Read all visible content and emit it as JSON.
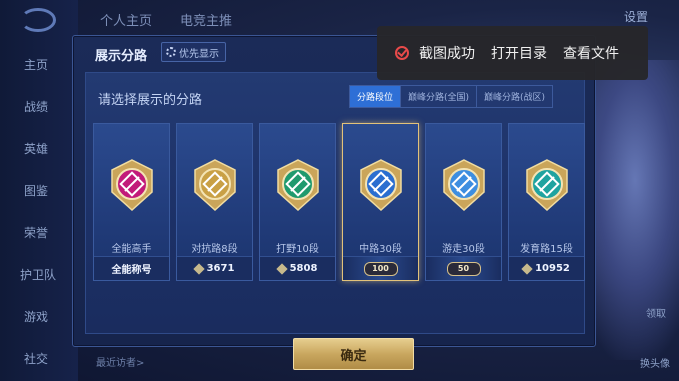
{
  "background": {
    "tabs": [
      "个人主页",
      "电竞主推"
    ],
    "settings_label": "设置",
    "nav": [
      "主页",
      "战绩",
      "英雄",
      "图鉴",
      "荣誉",
      "护卫队",
      "游戏",
      "社交"
    ],
    "bottom_text": "最近访者>",
    "side_labels": [
      "领取",
      "换头像"
    ]
  },
  "dialog": {
    "title": "展示分路",
    "pref_button": "优先显示",
    "prompt": "请选择展示的分路",
    "tabs": [
      "分路段位",
      "巅峰分路(全国)",
      "巅峰分路(战区)"
    ],
    "active_tab": 0,
    "cards": [
      {
        "name": "全能高手",
        "foot": "全能称号",
        "foot_type": "text",
        "emblem_color": "#c21a7a",
        "selected": false
      },
      {
        "name": "对抗路8段",
        "foot": "3671",
        "foot_type": "diamond",
        "emblem_color": "#c9a045",
        "selected": false
      },
      {
        "name": "打野10段",
        "foot": "5808",
        "foot_type": "diamond",
        "emblem_color": "#1f9a6e",
        "selected": false
      },
      {
        "name": "中路30段",
        "foot": "100",
        "foot_type": "badge",
        "emblem_color": "#2a6ed0",
        "selected": true
      },
      {
        "name": "游走30段",
        "foot": "50",
        "foot_type": "badge",
        "emblem_color": "#3d8ee0",
        "selected": false
      },
      {
        "name": "发育路15段",
        "foot": "10952",
        "foot_type": "diamond",
        "emblem_color": "#1fa3a0",
        "selected": false
      }
    ],
    "confirm": "确定"
  },
  "toast": {
    "message": "截图成功",
    "open_dir": "打开目录",
    "view_file": "查看文件"
  },
  "colors": {
    "accent_gold": "#e2c27a",
    "tab_active": "#2e6fd6",
    "toast_icon": "#e84a4a"
  }
}
